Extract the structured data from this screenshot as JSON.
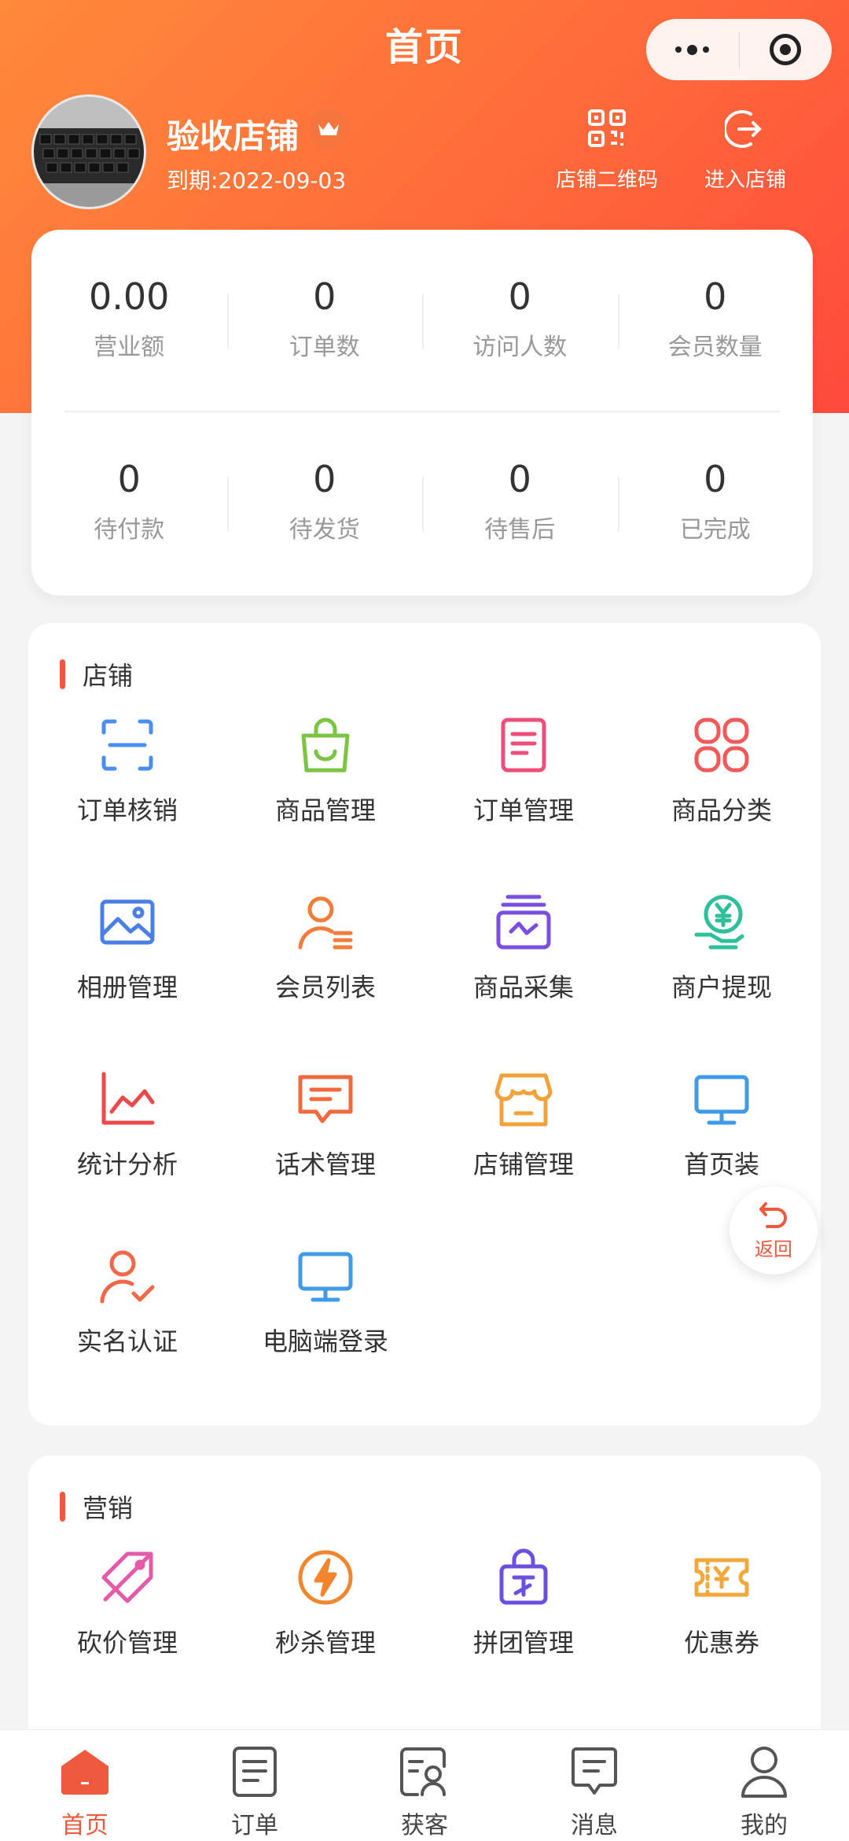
{
  "header": {
    "title": "首页",
    "store_name": "验收店铺",
    "expire": "到期:2022-09-03",
    "qr_label": "店铺二维码",
    "enter_label": "进入店铺"
  },
  "stats": {
    "row1": [
      {
        "value": "0.00",
        "label": "营业额"
      },
      {
        "value": "0",
        "label": "订单数"
      },
      {
        "value": "0",
        "label": "访问人数"
      },
      {
        "value": "0",
        "label": "会员数量"
      }
    ],
    "row2": [
      {
        "value": "0",
        "label": "待付款"
      },
      {
        "value": "0",
        "label": "待发货"
      },
      {
        "value": "0",
        "label": "待售后"
      },
      {
        "value": "0",
        "label": "已完成"
      }
    ]
  },
  "shop_section": {
    "title": "店铺",
    "items": [
      {
        "label": "订单核销",
        "icon": "scan-icon",
        "color": "#4a8ef0"
      },
      {
        "label": "商品管理",
        "icon": "shopping-bag-icon",
        "color": "#7cc443"
      },
      {
        "label": "订单管理",
        "icon": "document-icon",
        "color": "#ee4f7a"
      },
      {
        "label": "商品分类",
        "icon": "category-icon",
        "color": "#f05a5a"
      },
      {
        "label": "相册管理",
        "icon": "album-icon",
        "color": "#4a7fe8"
      },
      {
        "label": "会员列表",
        "icon": "member-icon",
        "color": "#f07d3a"
      },
      {
        "label": "商品采集",
        "icon": "collect-icon",
        "color": "#7a4fe0"
      },
      {
        "label": "商户提现",
        "icon": "withdraw-icon",
        "color": "#2fbf9a"
      },
      {
        "label": "统计分析",
        "icon": "chart-icon",
        "color": "#ec4a4a"
      },
      {
        "label": "话术管理",
        "icon": "message-icon",
        "color": "#f06a3e"
      },
      {
        "label": "店铺管理",
        "icon": "store-icon",
        "color": "#f2a23a"
      },
      {
        "label": "首页装",
        "icon": "monitor-icon",
        "color": "#3f9ae8"
      },
      {
        "label": "实名认证",
        "icon": "verify-user-icon",
        "color": "#f06a4a"
      },
      {
        "label": "电脑端登录",
        "icon": "desktop-icon",
        "color": "#3f9ae8"
      }
    ]
  },
  "marketing_section": {
    "title": "营销",
    "items": [
      {
        "label": "砍价管理",
        "icon": "price-cut-icon",
        "color": "#e45aa8"
      },
      {
        "label": "秒杀管理",
        "icon": "flash-icon",
        "color": "#f2862e"
      },
      {
        "label": "拼团管理",
        "icon": "group-buy-icon",
        "color": "#6a4fe0"
      },
      {
        "label": "优惠券",
        "icon": "coupon-icon",
        "color": "#f2a83a"
      }
    ]
  },
  "return_button": {
    "label": "返回"
  },
  "tabbar": [
    {
      "label": "首页",
      "active": true
    },
    {
      "label": "订单",
      "active": false
    },
    {
      "label": "获客",
      "active": false
    },
    {
      "label": "消息",
      "active": false
    },
    {
      "label": "我的",
      "active": false
    }
  ],
  "colors": {
    "accent": "#ee5a3e",
    "hero_start": "#ff8a3a",
    "hero_end": "#ff4a3c"
  }
}
